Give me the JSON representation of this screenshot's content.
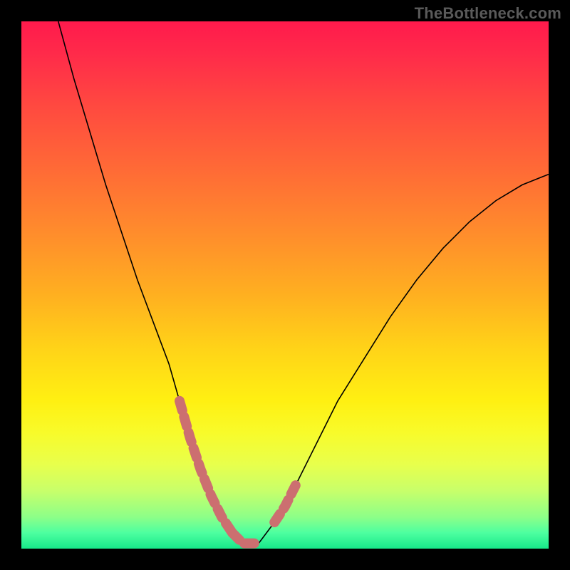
{
  "watermark": "TheBottleneck.com",
  "colors": {
    "frame": "#000000",
    "curve": "#000000",
    "highlight": "#cc6f70",
    "gradient_top": "#ff1a4c",
    "gradient_bottom": "#17e88a"
  },
  "chart_data": {
    "type": "line",
    "title": "",
    "xlabel": "",
    "ylabel": "",
    "xlim": [
      0,
      100
    ],
    "ylim": [
      0,
      100
    ],
    "grid": false,
    "legend": false,
    "note": "Axes are unlabeled; values estimated from pixel positions on a 0-100 normalized scale. y=0 is the bottom (green), y=100 is the top (red).",
    "series": [
      {
        "name": "bottleneck-curve",
        "x": [
          7,
          10,
          13,
          16,
          19,
          22,
          25,
          28,
          30,
          32,
          34,
          36,
          38,
          40,
          42,
          45,
          48,
          52,
          56,
          60,
          65,
          70,
          75,
          80,
          85,
          90,
          95,
          100
        ],
        "y": [
          100,
          89,
          79,
          69,
          60,
          51,
          43,
          35,
          28,
          21,
          15,
          10,
          6,
          3,
          1,
          1,
          5,
          12,
          20,
          28,
          36,
          44,
          51,
          57,
          62,
          66,
          69,
          71
        ]
      }
    ],
    "highlight_segments": [
      {
        "name": "valley-left-threshold",
        "x": [
          30,
          32,
          34,
          36,
          38,
          40
        ],
        "y": [
          28,
          21,
          15,
          10,
          6,
          3
        ]
      },
      {
        "name": "valley-floor",
        "x": [
          40,
          42,
          45
        ],
        "y": [
          3,
          1,
          1
        ]
      },
      {
        "name": "valley-right-threshold",
        "x": [
          48,
          50,
          52
        ],
        "y": [
          5,
          8,
          12
        ]
      }
    ]
  }
}
